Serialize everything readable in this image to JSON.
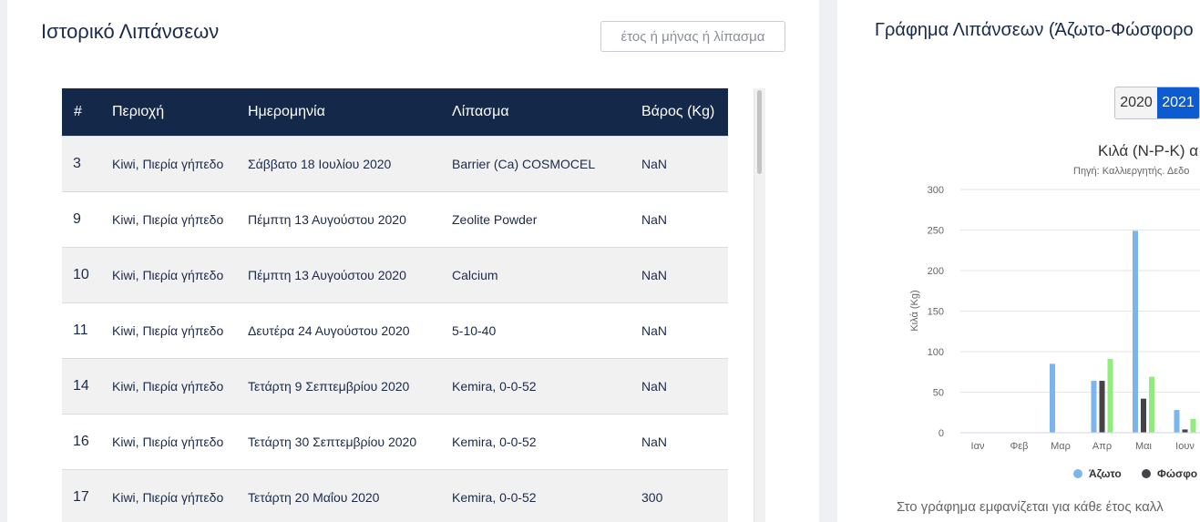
{
  "history": {
    "title": "Ιστορικό Λιπάνσεων",
    "search_placeholder": "έτος ή μήνας ή λίπασμα",
    "columns": [
      "#",
      "Περιοχή",
      "Ημερομηνία",
      "Λίπασμα",
      "Βάρος (Kg)"
    ],
    "rows": [
      {
        "id": "3",
        "area": "Kiwi, Πιερία γήπεδο",
        "date": "Σάββατο 18 Ιουλίου 2020",
        "fertilizer": "Barrier (Ca) COSMOCEL",
        "weight": "NaN"
      },
      {
        "id": "9",
        "area": "Kiwi, Πιερία γήπεδο",
        "date": "Πέμπτη 13 Αυγούστου 2020",
        "fertilizer": "Zeolite Powder",
        "weight": "NaN"
      },
      {
        "id": "10",
        "area": "Kiwi, Πιερία γήπεδο",
        "date": "Πέμπτη 13 Αυγούστου 2020",
        "fertilizer": "Calcium",
        "weight": "NaN"
      },
      {
        "id": "11",
        "area": "Kiwi, Πιερία γήπεδο",
        "date": "Δευτέρα 24 Αυγούστου 2020",
        "fertilizer": "5-10-40",
        "weight": "NaN"
      },
      {
        "id": "14",
        "area": "Kiwi, Πιερία γήπεδο",
        "date": "Τετάρτη 9 Σεπτεμβρίου 2020",
        "fertilizer": "Kemira, 0-0-52",
        "weight": "NaN"
      },
      {
        "id": "16",
        "area": "Kiwi, Πιερία γήπεδο",
        "date": "Τετάρτη 30 Σεπτεμβρίου 2020",
        "fertilizer": "Kemira, 0-0-52",
        "weight": "NaN"
      },
      {
        "id": "17",
        "area": "Kiwi, Πιερία γήπεδο",
        "date": "Τετάρτη 20 Μαΐου 2020",
        "fertilizer": "Kemira, 0-0-52",
        "weight": "300"
      }
    ]
  },
  "chart_panel": {
    "title": "Γράφημα Λιπάνσεων (Άζωτο-Φώσφορο",
    "years": [
      "2020",
      "2021"
    ],
    "active_year": "2021",
    "caption": "Στο γράφημα εμφανίζεται για κάθε έτος καλλ"
  },
  "chart_data": {
    "type": "bar",
    "title": "Κιλά (N-P-K) α",
    "subtitle": "Πηγή: Καλλιεργητής. Δεδο",
    "ylabel": "Κιλά (Kg)",
    "xlabel": "",
    "ylim": [
      0,
      300
    ],
    "yticks": [
      0,
      50,
      100,
      150,
      200,
      250,
      300
    ],
    "grid": true,
    "legend_position": "bottom",
    "categories": [
      "Ιαν",
      "Φεβ",
      "Μαρ",
      "Απρ",
      "Μαι",
      "Ιουν"
    ],
    "series": [
      {
        "name": "Άζωτο",
        "color": "#7cb5ec",
        "values": [
          0,
          0,
          85,
          64,
          249,
          28
        ]
      },
      {
        "name": "Φώσφο",
        "color": "#434348",
        "values": [
          0,
          0,
          0,
          64,
          42,
          4
        ]
      },
      {
        "name": "",
        "color": "#90ed7d",
        "values": [
          0,
          0,
          0,
          91,
          69,
          17
        ]
      }
    ]
  }
}
